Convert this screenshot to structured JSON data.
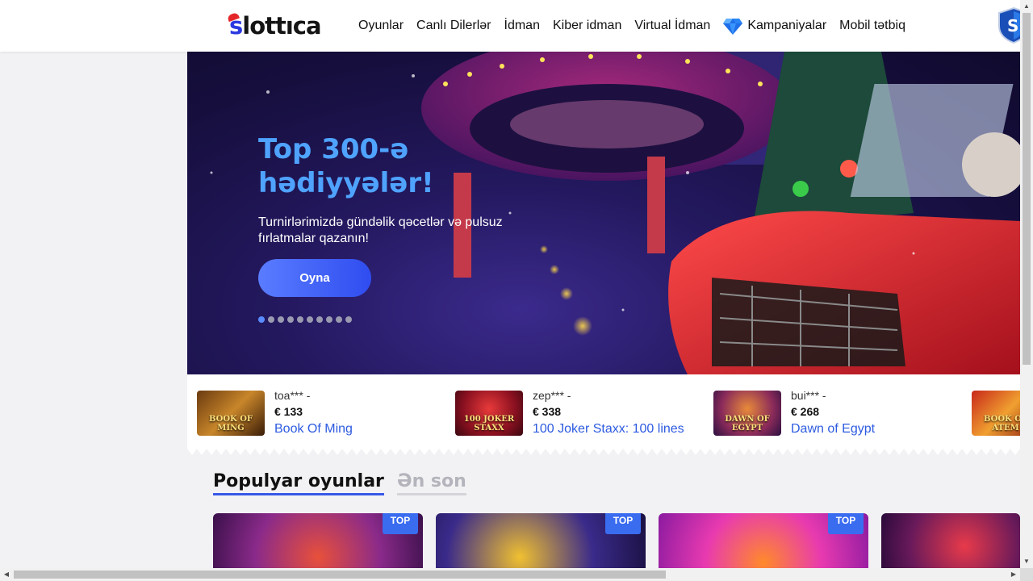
{
  "header": {
    "logo_text_1": "s",
    "logo_text_2": "lott",
    "logo_text_3": "ıca",
    "nav": [
      {
        "label": "Oyunlar"
      },
      {
        "label": "Canlı Dilerlər"
      },
      {
        "label": "İdman"
      },
      {
        "label": "Kiber idman"
      },
      {
        "label": "Virtual İdman"
      },
      {
        "label": "Kampaniyalar"
      },
      {
        "label": "Mobil tətbiq"
      }
    ]
  },
  "hero": {
    "title": "Top 300-ə hədiyyələr!",
    "subtitle": "Turnirlərimizdə gündəlik qəcetlər və pulsuz fırlatmalar qazanın!",
    "button": "Oyna",
    "slide_count": 10,
    "active_slide": 1
  },
  "winners": [
    {
      "user": "toa*** -",
      "amount": "€ 133",
      "game": "Book Of Ming",
      "thumb_label": "BOOK OF MING"
    },
    {
      "user": "zep*** -",
      "amount": "€ 338",
      "game": "100 Joker Staxx: 100 lines",
      "thumb_label": "100 JOKER STAXX"
    },
    {
      "user": "bui*** -",
      "amount": "€ 268",
      "game": "Dawn of Egypt",
      "thumb_label": "DAWN OF EGYPT"
    },
    {
      "user": "",
      "amount": "",
      "game": "",
      "thumb_label": "BOOK OF ATEM"
    }
  ],
  "popular": {
    "tabs": [
      {
        "label": "Populyar oyunlar",
        "active": true
      },
      {
        "label": "Ən son",
        "active": false
      }
    ],
    "badge": "TOP"
  },
  "colors": {
    "accent": "#3858e8",
    "link": "#2d5be0",
    "hero_title": "#4fa3ff"
  }
}
